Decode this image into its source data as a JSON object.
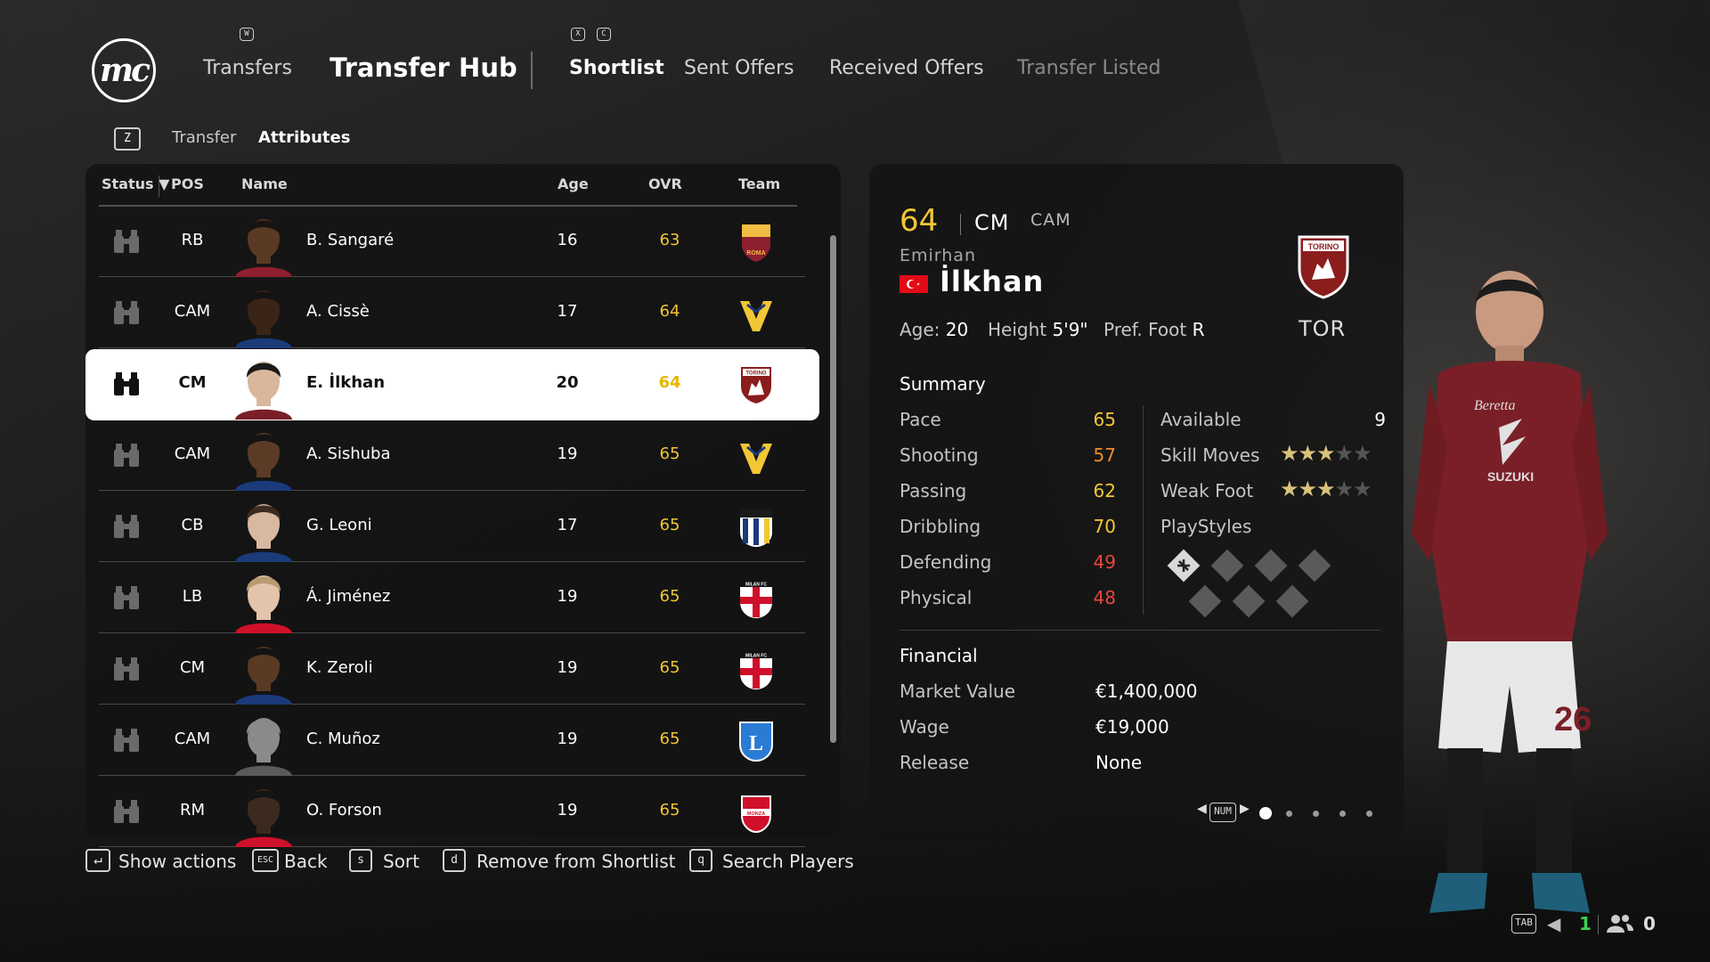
{
  "header": {
    "logo": "mc",
    "nav": [
      {
        "label": "Transfers",
        "key": "W"
      },
      {
        "label": "Transfer Hub"
      },
      {
        "label": "Shortlist",
        "keys": [
          "X",
          "C"
        ]
      },
      {
        "label": "Sent Offers"
      },
      {
        "label": "Received Offers"
      },
      {
        "label": "Transfer Listed"
      }
    ]
  },
  "subnav": {
    "key": "Z",
    "items": [
      "Transfer",
      "Attributes"
    ]
  },
  "table": {
    "headers": [
      "Status",
      "POS",
      "Name",
      "Age",
      "OVR",
      "Team"
    ],
    "rows": [
      {
        "pos": "RB",
        "name": "B. Sangaré",
        "age": "16",
        "ovr": "63",
        "team": "roma-crest-icon"
      },
      {
        "pos": "CAM",
        "name": "A. Cissè",
        "age": "17",
        "ovr": "64",
        "team": "verona-crest-icon"
      },
      {
        "pos": "CM",
        "name": "E. İlkhan",
        "age": "20",
        "ovr": "64",
        "team": "torino-crest-icon"
      },
      {
        "pos": "CAM",
        "name": "A. Sishuba",
        "age": "19",
        "ovr": "65",
        "team": "verona-crest-icon"
      },
      {
        "pos": "CB",
        "name": "G. Leoni",
        "age": "17",
        "ovr": "65",
        "team": "parma-crest-icon"
      },
      {
        "pos": "LB",
        "name": "Á. Jiménez",
        "age": "19",
        "ovr": "65",
        "team": "milan-crest-icon"
      },
      {
        "pos": "CM",
        "name": "K. Zeroli",
        "age": "19",
        "ovr": "65",
        "team": "milan-crest-icon"
      },
      {
        "pos": "CAM",
        "name": "C. Muñoz",
        "age": "19",
        "ovr": "65",
        "team": "lecce-crest-icon"
      },
      {
        "pos": "RM",
        "name": "O. Forson",
        "age": "19",
        "ovr": "65",
        "team": "monza-crest-icon"
      }
    ]
  },
  "detail": {
    "ovr": "64",
    "position": "CM",
    "alt_position": "CAM",
    "first_name": "Emirhan",
    "last_name": "İlkhan",
    "age_label": "Age:",
    "age": "20",
    "height_label": "Height",
    "height": "5'9\"",
    "foot_label": "Pref. Foot",
    "foot": "R",
    "club": "TOR",
    "summary_title": "Summary",
    "stats": [
      {
        "label": "Pace",
        "value": "65",
        "color": "#f2c634"
      },
      {
        "label": "Shooting",
        "value": "57",
        "color": "#f28c28"
      },
      {
        "label": "Passing",
        "value": "62",
        "color": "#f2c634"
      },
      {
        "label": "Dribbling",
        "value": "70",
        "color": "#f2c634"
      },
      {
        "label": "Defending",
        "value": "49",
        "color": "#e8473b"
      },
      {
        "label": "Physical",
        "value": "48",
        "color": "#e8473b"
      }
    ],
    "available_label": "Available",
    "available": "9",
    "skill_label": "Skill Moves",
    "skill_stars": 3,
    "weak_label": "Weak Foot",
    "weak_stars": 3,
    "playstyles_label": "PlayStyles",
    "financial_title": "Financial",
    "financial": [
      {
        "label": "Market Value",
        "value": "€1,400,000"
      },
      {
        "label": "Wage",
        "value": "€19,000"
      },
      {
        "label": "Release",
        "value": "None"
      }
    ],
    "pager_key": "NUM",
    "page_count": 5,
    "page_current": 1
  },
  "hints": [
    {
      "key": "↵",
      "label": "Show actions"
    },
    {
      "key": "ESC",
      "label": "Back"
    },
    {
      "key": "s",
      "label": "Sort"
    },
    {
      "key": "d",
      "label": "Remove from Shortlist"
    },
    {
      "key": "q",
      "label": "Search Players"
    }
  ],
  "status_bar": {
    "key": "TAB",
    "count1": "1",
    "count2": "0"
  },
  "colors": {
    "ovr": "#f2c634",
    "panel": "#141414",
    "accent_green": "#3ecf4f"
  }
}
